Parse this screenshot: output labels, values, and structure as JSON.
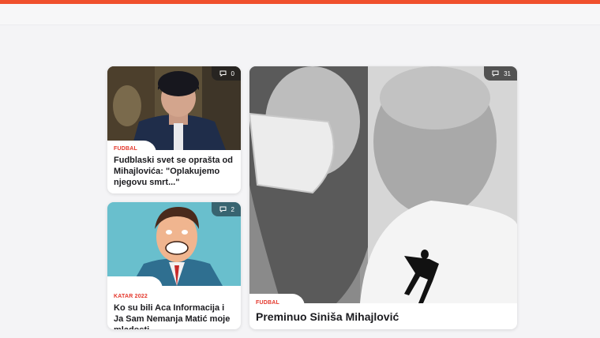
{
  "cards": [
    {
      "category": "FUDBAL",
      "title": "Fudblaski svet se oprašta od Mihajlovića: \"Oplakujemo njegovu smrt...\"",
      "comments": "0"
    },
    {
      "category": "KATAR 2022",
      "title": "Ko su bili Aca Informacija i Ja Sam Nemanja Matić moje mladosti",
      "comments": "2"
    },
    {
      "category": "FUDBAL",
      "title": "Preminuo Siniša Mihajlović",
      "comments": "31"
    }
  ],
  "colors": {
    "accent": "#f0502d",
    "category": "#e4372b"
  },
  "icons": {
    "comment": "comment-bubble-icon"
  }
}
